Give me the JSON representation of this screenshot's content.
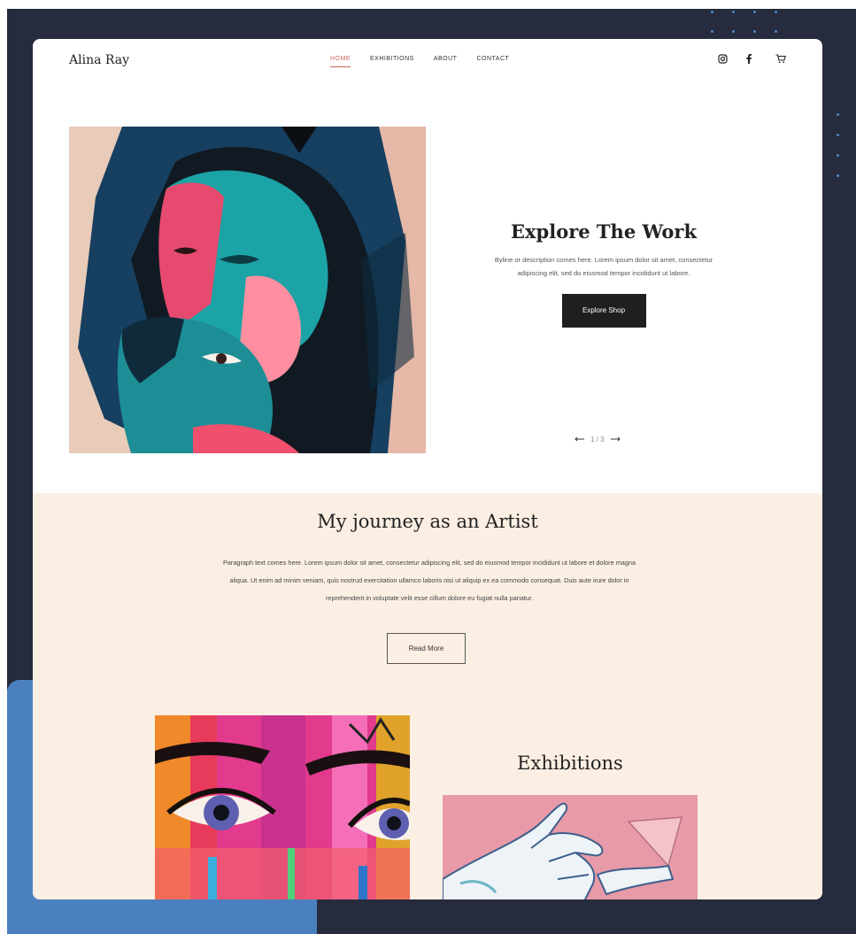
{
  "header": {
    "brand": "Alina Ray",
    "nav": [
      "HOME",
      "EXHIBITIONS",
      "ABOUT",
      "CONTACT"
    ],
    "active_nav": "HOME",
    "icons": [
      "instagram-icon",
      "facebook-icon",
      "cart-icon"
    ]
  },
  "hero": {
    "title": "Explore The Work",
    "description": "Byline or description comes here. Lorem ipsum dolor sit amet, consectetur adipiscing elit, sed do eiusmod tempor incididunt ut labore.",
    "button": "Explore Shop",
    "pager": "1 / 3"
  },
  "journey": {
    "title": "My journey as an Artist",
    "paragraph": "Paragraph text comes here. Lorem ipsum dolor sit amet, consectetur adipiscing elit, sed do eiusmod tempor incididunt ut labore et dolore magna aliqua. Ut enim ad minim veniam, quis nostrud exercitation ullamco laboris nisi ut aliquip ex ea commodo consequat. Duis aute irure dolor in reprehenderit in voluptate velit esse cillum dolore eu fugiat nulla pariatur.",
    "button": "Read More"
  },
  "exhibitions": {
    "title": "Exhibitions"
  },
  "colors": {
    "frame": "#262b3d",
    "accent_blue": "#4b80c0",
    "cream": "#fbefe3",
    "active_nav": "#c7655a"
  }
}
